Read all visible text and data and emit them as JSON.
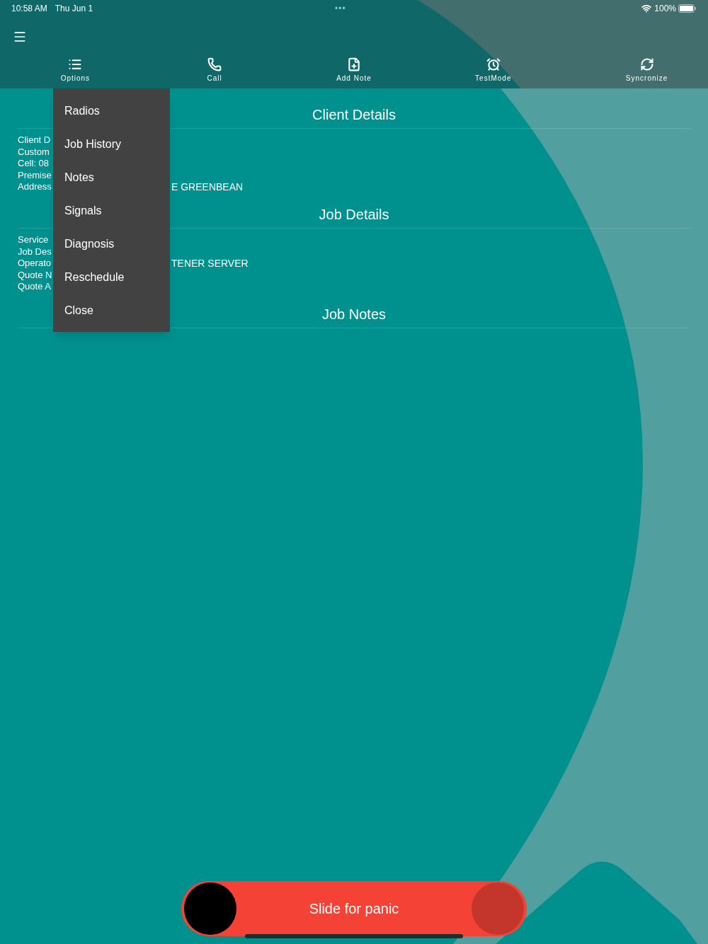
{
  "status_bar": {
    "time": "10:58 AM",
    "date": "Thu Jun 1",
    "dots": "•••",
    "battery": "100%"
  },
  "toolbar": [
    {
      "label": "Options"
    },
    {
      "label": "Call"
    },
    {
      "label": "Add Note"
    },
    {
      "label": "TestMode"
    },
    {
      "label": "Syncronize"
    }
  ],
  "sections": [
    {
      "title": "Client Details",
      "lines": [
        {
          "label": "Client D"
        },
        {
          "label": "Custom"
        },
        {
          "label": "Cell: 08"
        },
        {
          "label": "Premise"
        },
        {
          "label": "Address",
          "tail": "E GREENBEAN"
        }
      ]
    },
    {
      "title": "Job Details",
      "lines": [
        {
          "label": "Service"
        },
        {
          "label": "Job Des"
        },
        {
          "label": "Operato",
          "tail": "TENER SERVER"
        },
        {
          "label": "Quote N"
        },
        {
          "label": "Quote A"
        }
      ]
    },
    {
      "title": "Job Notes"
    }
  ],
  "menu": {
    "items": [
      "Radios",
      "Job History",
      "Notes",
      "Signals",
      "Diagnosis",
      "Reschedule",
      "Close"
    ]
  },
  "panic_slider": {
    "label": "Slide for panic",
    "level": 0
  }
}
